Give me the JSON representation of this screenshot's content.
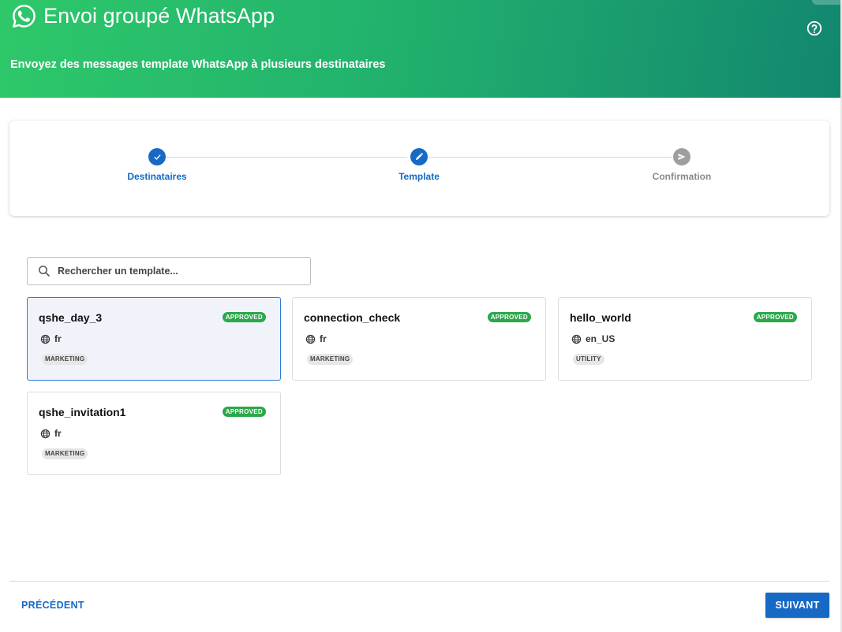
{
  "header": {
    "title": "Envoi groupé WhatsApp",
    "subtitle": "Envoyez des messages template WhatsApp à plusieurs destinataires",
    "icon": "whatsapp-icon",
    "help_icon": "help-circle-icon"
  },
  "stepper": {
    "steps": [
      {
        "label": "Destinataires",
        "state": "done",
        "icon": "check-icon"
      },
      {
        "label": "Template",
        "state": "active",
        "icon": "pencil-icon"
      },
      {
        "label": "Confirmation",
        "state": "pending",
        "icon": "send-icon"
      }
    ]
  },
  "search": {
    "placeholder": "Rechercher un template...",
    "value": ""
  },
  "templates": [
    {
      "name": "qshe_day_3",
      "status": "APPROVED",
      "language": "fr",
      "category": "MARKETING",
      "selected": true
    },
    {
      "name": "connection_check",
      "status": "APPROVED",
      "language": "fr",
      "category": "MARKETING",
      "selected": false
    },
    {
      "name": "hello_world",
      "status": "APPROVED",
      "language": "en_US",
      "category": "UTILITY",
      "selected": false
    },
    {
      "name": "qshe_invitation1",
      "status": "APPROVED",
      "language": "fr",
      "category": "MARKETING",
      "selected": false
    }
  ],
  "footer": {
    "prev_label": "PRÉCÉDENT",
    "next_label": "SUIVANT"
  },
  "colors": {
    "primary": "#1769c6",
    "header_gradient_start": "#2ec86a",
    "header_gradient_end": "#12876f",
    "approved_badge": "#2aa84a",
    "pending_step": "#9e9e9e"
  }
}
